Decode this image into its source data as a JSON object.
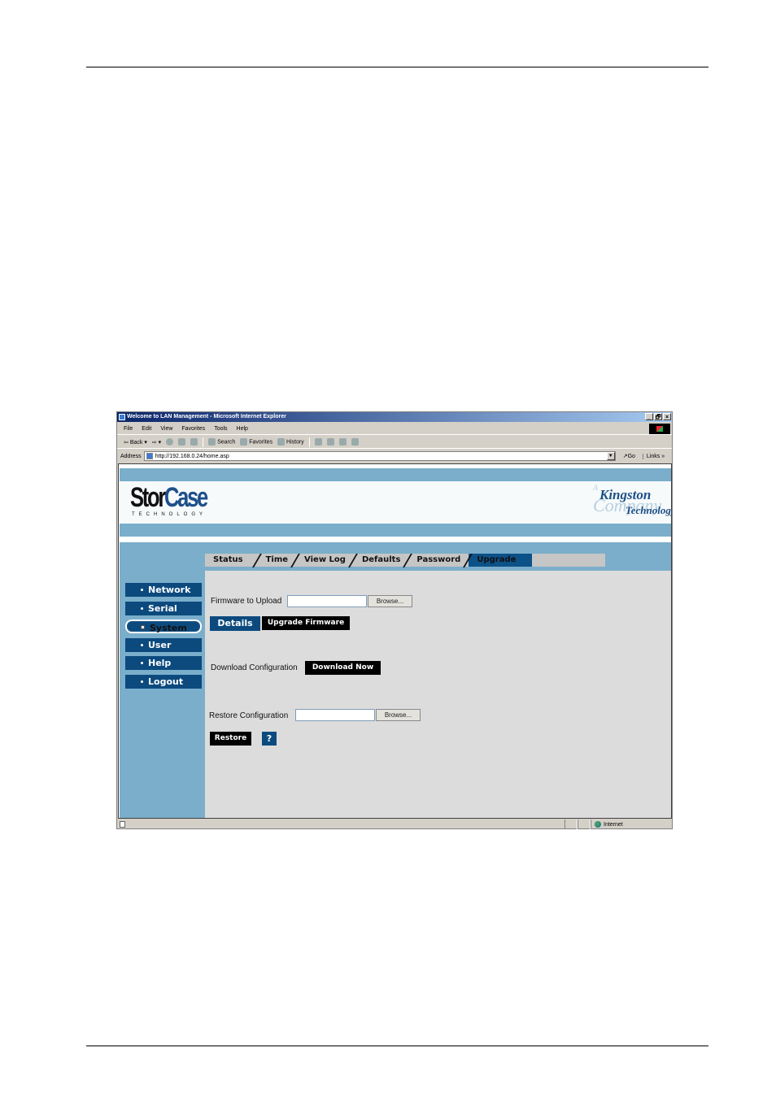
{
  "browser": {
    "title": "Welcome to LAN Management - Microsoft Internet Explorer",
    "window_controls": [
      "_",
      "🗗",
      "×"
    ],
    "menu": [
      "File",
      "Edit",
      "View",
      "Favorites",
      "Tools",
      "Help"
    ],
    "toolbar": {
      "back": "Back",
      "search": "Search",
      "favorites": "Favorites",
      "history": "History"
    },
    "address_label": "Address",
    "address_value": "http://192.168.0.24/home.asp",
    "go_label": "Go",
    "links_label": "Links »",
    "status_zone": "Internet"
  },
  "header": {
    "logo_left_stor": "Stor",
    "logo_left_case": "Case",
    "logo_left_sub": "TECHNOLOGY",
    "logo_right_a": "A",
    "logo_right_kingston": "Kingston",
    "logo_right_company": "Company",
    "logo_right_technology": "Technology"
  },
  "tabs": [
    {
      "label": "Status",
      "active": false
    },
    {
      "label": "Time",
      "active": false
    },
    {
      "label": "View Log",
      "active": false
    },
    {
      "label": "Defaults",
      "active": false
    },
    {
      "label": "Password",
      "active": false
    },
    {
      "label": "Upgrade",
      "active": true
    }
  ],
  "sidebar": {
    "items": [
      {
        "label": "Network",
        "active": false
      },
      {
        "label": "Serial",
        "active": false
      },
      {
        "label": "System",
        "active": true
      },
      {
        "label": "User",
        "active": false
      },
      {
        "label": "Help",
        "active": false
      },
      {
        "label": "Logout",
        "active": false
      }
    ]
  },
  "upgrade": {
    "firmware_label": "Firmware to Upload",
    "firmware_value": "",
    "browse_label": "Browse...",
    "details_label": "Details",
    "upgrade_label": "Upgrade Firmware",
    "download_config_label": "Download Configuration",
    "download_now_label": "Download Now",
    "restore_config_label": "Restore Configuration",
    "restore_value": "",
    "restore_browse_label": "Browse...",
    "restore_label": "Restore",
    "help_label": "?"
  }
}
